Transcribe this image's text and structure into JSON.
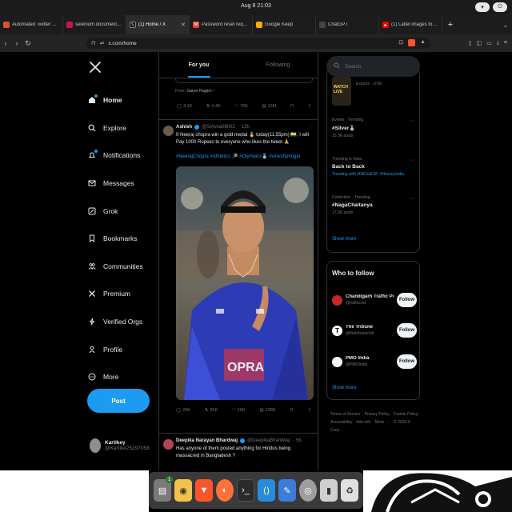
{
  "os": {
    "clock": "Aug 8  21:03"
  },
  "tabs": [
    {
      "title": "Automated Twitter Scrolling",
      "favicon_color": "#d9532c",
      "active": false
    },
    {
      "title": "selenium documentation - G",
      "favicon_color": "#c2185b",
      "active": false
    },
    {
      "title": "(1) Home / X",
      "favicon_color": "#000000",
      "active": true
    },
    {
      "title": "Password reset request - b",
      "favicon_color": "#ea4335",
      "active": false
    },
    {
      "title": "Google Keep",
      "favicon_color": "#f9ab00",
      "active": false
    },
    {
      "title": "ChatGPT",
      "favicon_color": "#444444",
      "active": false
    },
    {
      "title": "(1) Label images for Object",
      "favicon_color": "#ff0000",
      "active": false
    }
  ],
  "address": {
    "url": "x.com/home"
  },
  "sidebar": {
    "items": [
      {
        "label": "Home",
        "icon": "home-icon"
      },
      {
        "label": "Explore",
        "icon": "search-icon"
      },
      {
        "label": "Notifications",
        "icon": "bell-icon"
      },
      {
        "label": "Messages",
        "icon": "mail-icon"
      },
      {
        "label": "Grok",
        "icon": "grok-icon"
      },
      {
        "label": "Bookmarks",
        "icon": "bookmark-icon"
      },
      {
        "label": "Communities",
        "icon": "people-icon"
      },
      {
        "label": "Premium",
        "icon": "x-icon"
      },
      {
        "label": "Verified Orgs",
        "icon": "lightning-icon"
      },
      {
        "label": "Profile",
        "icon": "person-icon"
      },
      {
        "label": "More",
        "icon": "more-circle-icon"
      }
    ],
    "post_label": "Post",
    "account": {
      "name": "Kartikey",
      "handle": "@Kartike25297058"
    }
  },
  "timeline": {
    "tabs": [
      "For you",
      "Following"
    ],
    "prev_tweet": {
      "from_label": "From",
      "from_name": "Saiee Ragini",
      "stats": {
        "replies": "3.1K",
        "reposts": "4.4K",
        "likes": "75K",
        "views": "13M"
      }
    },
    "tweet": {
      "name": "Ashish",
      "handle": "@SiAsha08h02",
      "time": "13h",
      "text": "If Neeraj chopra win a gold medal 🥇 today(11.55pm) 🇮🇳, I will Pay 1000 Rupees to everyone who likes the tweet 🙏",
      "hashtags": "#NeerajChopra #Athletics 🔎 #Olympics🥈 #vineshphogat",
      "stats": {
        "replies": "20K",
        "reposts": "25K",
        "likes": "10K",
        "views": "228K"
      }
    },
    "next_tweet": {
      "name": "Deepika Narayan Bhardwaj",
      "handle": "@DeepikaBhardwaj",
      "time": "5h",
      "text": "Has anyone of them posted anything for Hindus being massacred in Bangladesh ?"
    }
  },
  "right": {
    "search_placeholder": "Search",
    "trends": [
      {
        "meta": "Esports · LIVE",
        "title": "",
        "count": "",
        "image": true
      },
      {
        "meta": "Events · Trending",
        "title": "#Silver🥈",
        "count": "15.3K posts"
      },
      {
        "meta": "Trending in India",
        "title": "Back to Back",
        "count": "Trending with #INDvsESP, #HockeyIndia"
      },
      {
        "meta": "Celebrities · Trending",
        "title": "#NagaChaitanya",
        "count": "17.3K posts"
      }
    ],
    "trends_show_more": "Show more",
    "who_to_follow": {
      "title": "Who to follow",
      "accounts": [
        {
          "name": "Chandigarh Traffic Police",
          "handle": "@trafficchd",
          "avatar_color": "#c62828"
        },
        {
          "name": "The Tribune",
          "handle": "@thetribunechd",
          "avatar_color": "#ffffff"
        },
        {
          "name": "PMO India",
          "handle": "@PMOIndia",
          "avatar_color": "#f5f5f5"
        }
      ],
      "follow_label": "Follow",
      "show_more": "Show more"
    },
    "footer": [
      "Terms of Service",
      "Privacy Policy",
      "Cookie Policy",
      "Accessibility",
      "Ads info",
      "More ···",
      "© 2024 X Corp."
    ]
  },
  "dock": {
    "badge": "1",
    "apps": [
      {
        "name": "files-icon",
        "color": "#7a7a7a"
      },
      {
        "name": "rhythmbox-icon",
        "color": "#f2c14e"
      },
      {
        "name": "brave-icon",
        "color": "#fb542b"
      },
      {
        "name": "firefox-icon",
        "color": "#ff7139"
      },
      {
        "name": "terminal-icon",
        "color": "#2b2b2b"
      },
      {
        "name": "vscode-icon",
        "color": "#2a8cd8"
      },
      {
        "name": "text-editor-icon",
        "color": "#3c7dd9"
      },
      {
        "name": "disks-icon",
        "color": "#9e9e9e"
      },
      {
        "name": "usb-creator-icon",
        "color": "#cfcfcf"
      },
      {
        "name": "recycle-icon",
        "color": "#e0e0e0"
      }
    ]
  }
}
